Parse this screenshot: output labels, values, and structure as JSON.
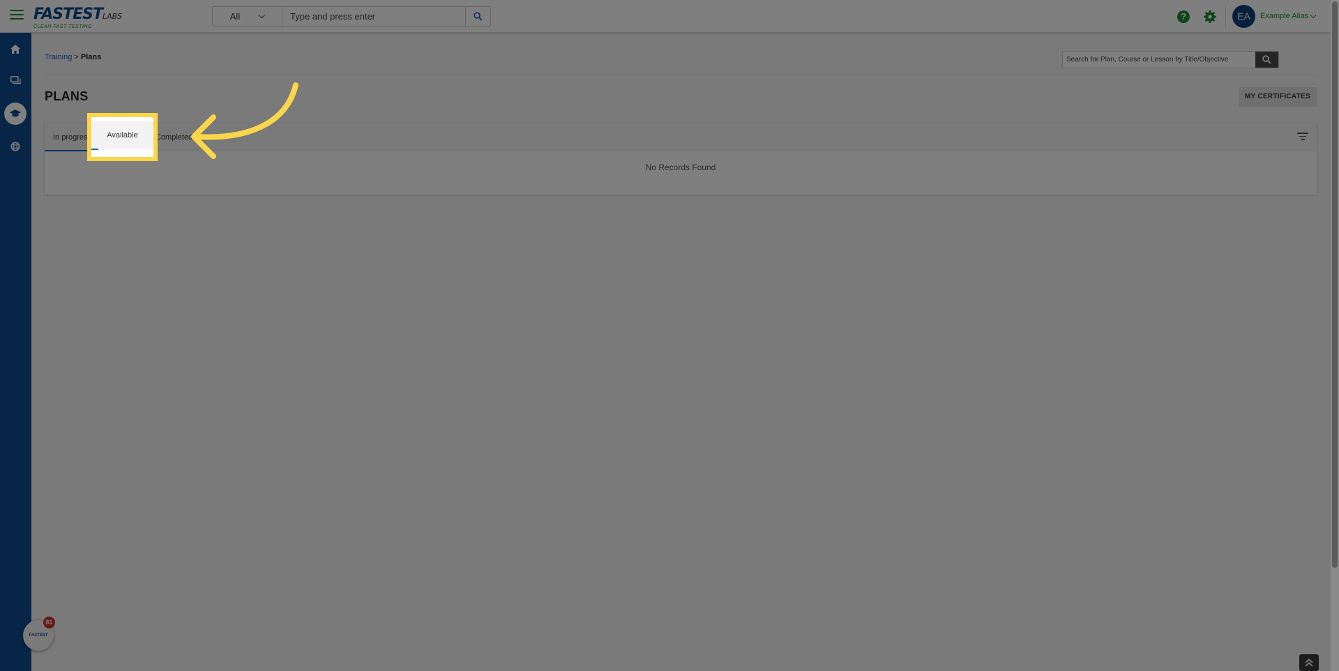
{
  "header": {
    "logo_text": "FASTEST",
    "logo_suffix": "LABS",
    "logo_tagline": "CLEAN FAST TESTING",
    "search_scope": "All",
    "search_placeholder": "Type and press enter",
    "user_initials": "EA",
    "user_name": "Example Alias"
  },
  "breadcrumb": {
    "parent": "Training",
    "separator": ">",
    "current": "Plans"
  },
  "plan_search": {
    "placeholder": "Search for Plan, Course or Lesson by Title/Objective"
  },
  "page": {
    "title": "PLANS",
    "certificates_label": "MY CERTIFICATES"
  },
  "tabs": {
    "in_progress": "In progress",
    "available": "Available",
    "completed": "Completed"
  },
  "empty_message": "No Records Found",
  "chat": {
    "badge_count": "81",
    "widget_text": "FASTEST"
  },
  "colors": {
    "brand_blue": "#0d4a8f",
    "brand_green": "#1c8a2e",
    "highlight": "#f9d64a"
  }
}
